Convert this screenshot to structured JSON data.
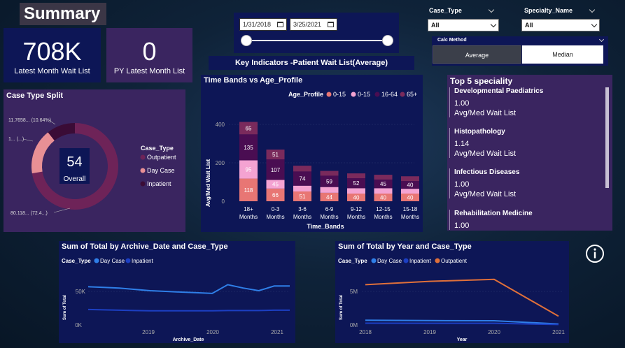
{
  "header": {
    "title": "Summary"
  },
  "kpis": [
    {
      "value": "708K",
      "label": "Latest Month Wait List"
    },
    {
      "value": "0",
      "label": "PY Latest Month List"
    }
  ],
  "date_slicer": {
    "start": "1/31/2018",
    "end": "3/25/2021"
  },
  "slicers": {
    "case_type": {
      "label": "Case_Type",
      "selected": "All"
    },
    "specialty": {
      "label": "Specialty_Name",
      "selected": "All"
    }
  },
  "calc_method": {
    "label": "Calc Method",
    "options": [
      "Average",
      "Median"
    ],
    "selected": "Average"
  },
  "key_indicators": "Key Indicators -Patient Wait List(Average)",
  "case_type_split": {
    "title": "Case Type Split",
    "center_value": "54",
    "center_label": "Overall",
    "legend_title": "Case_Type",
    "slices": [
      {
        "name": "Outpatient",
        "value": 72.4,
        "label": "80.118... (72.4...)",
        "color": "#6e2358"
      },
      {
        "name": "Day Case",
        "value": 16.96,
        "label": "1... (...)",
        "color": "#e89095"
      },
      {
        "name": "Inpatient",
        "value": 10.64,
        "label": "11.7658... (10.64%)",
        "color": "#3a0c36"
      }
    ]
  },
  "time_bands": {
    "title": "Time Bands vs Age_Profile",
    "legend_title": "Age_Profile",
    "legend": [
      {
        "name": "0-15",
        "color": "#e87674"
      },
      {
        "name": "0-15",
        "color": "#f4a3d2"
      },
      {
        "name": "16-64",
        "color": "#4a0d52"
      },
      {
        "name": "65+",
        "color": "#7a2a5c"
      }
    ],
    "ylabel": "Avg/Med Wait List",
    "xlabel": "Time_Bands",
    "yticks": [
      "0",
      "200",
      "400"
    ],
    "categories": [
      [
        "18+",
        "Months"
      ],
      [
        "0-3",
        "Months"
      ],
      [
        "3-6",
        "Months"
      ],
      [
        "6-9",
        "Months"
      ],
      [
        "9-12",
        "Months"
      ],
      [
        "12-15",
        "Months"
      ],
      [
        "15-18",
        "Months"
      ]
    ]
  },
  "top5": {
    "title": "Top 5 speciality",
    "items": [
      {
        "name": "Developmental Paediatrics",
        "value": "1.00",
        "sub": "Avg/Med Wait List"
      },
      {
        "name": "Histopathology",
        "value": "1.14",
        "sub": "Avg/Med Wait List"
      },
      {
        "name": "Infectious Diseases",
        "value": "1.00",
        "sub": "Avg/Med Wait List"
      },
      {
        "name": "Rehabilitation Medicine",
        "value": "1.00",
        "sub": ""
      }
    ]
  },
  "archive_chart": {
    "title": "Sum of Total by Archive_Date and Case_Type",
    "legend_title": "Case_Type",
    "legend": [
      {
        "name": "Day Case",
        "color": "#2f7fe8"
      },
      {
        "name": "Inpatient",
        "color": "#1c3fc2"
      }
    ],
    "ylabel": "Sum of Total",
    "xlabel": "Archive_Date",
    "yticks": [
      "0K",
      "50K"
    ],
    "xticks": [
      "2019",
      "2020",
      "2021"
    ]
  },
  "year_chart": {
    "title": "Sum of Total by Year and Case_Type",
    "legend_title": "Case_Type",
    "legend": [
      {
        "name": "Day Case",
        "color": "#2f7fe8"
      },
      {
        "name": "Inpatient",
        "color": "#1c3fc2"
      },
      {
        "name": "Outpatient",
        "color": "#e0703a"
      }
    ],
    "ylabel": "Sum of Total",
    "xlabel": "Year",
    "yticks": [
      "0M",
      "5M"
    ],
    "xticks": [
      "2018",
      "2019",
      "2020",
      "2021"
    ]
  },
  "chart_data": [
    {
      "type": "pie",
      "title": "Case Type Split",
      "categories": [
        "Outpatient",
        "Day Case",
        "Inpatient"
      ],
      "values": [
        72.4,
        16.96,
        10.64
      ]
    },
    {
      "type": "bar",
      "title": "Time Bands vs Age_Profile",
      "xlabel": "Time_Bands",
      "ylabel": "Avg/Med Wait List",
      "ylim": [
        0,
        450
      ],
      "categories": [
        "18+ Months",
        "0-3 Months",
        "3-6 Months",
        "6-9 Months",
        "9-12 Months",
        "12-15 Months",
        "15-18 Months"
      ],
      "series": [
        {
          "name": "0-15",
          "color": "#e87674",
          "values": [
            118,
            66,
            51,
            44,
            40,
            40,
            40
          ]
        },
        {
          "name": "0-15",
          "color": "#f4a3d2",
          "values": [
            95,
            45,
            30,
            30,
            28,
            28,
            25
          ]
        },
        {
          "name": "16-64",
          "color": "#4a0d52",
          "values": [
            135,
            107,
            74,
            59,
            52,
            45,
            40
          ]
        },
        {
          "name": "65+",
          "color": "#7a2a5c",
          "values": [
            65,
            51,
            30,
            25,
            25,
            25,
            25
          ]
        }
      ],
      "data_labels": [
        [
          "118",
          "95",
          "135",
          "65"
        ],
        [
          "66",
          "45",
          "107",
          "51"
        ],
        [
          "51",
          "",
          "74",
          ""
        ],
        [
          "44",
          "",
          "59",
          ""
        ],
        [
          "40",
          "",
          "52",
          ""
        ],
        [
          "40",
          "",
          "45",
          ""
        ],
        [
          "40",
          "",
          "40",
          ""
        ]
      ]
    },
    {
      "type": "line",
      "title": "Sum of Total by Archive_Date and Case_Type",
      "xlabel": "Archive_Date",
      "ylabel": "Sum of Total",
      "ylim": [
        0,
        70000
      ],
      "x": [
        "2018-01",
        "2018-04",
        "2018-07",
        "2018-10",
        "2019-01",
        "2019-04",
        "2019-07",
        "2019-10",
        "2020-01",
        "2020-04",
        "2020-07",
        "2020-10",
        "2021-01",
        "2021-03"
      ],
      "series": [
        {
          "name": "Day Case",
          "values": [
            57000,
            56000,
            55000,
            53000,
            51000,
            50000,
            49000,
            48000,
            47000,
            60000,
            55000,
            51000,
            58000,
            58000
          ]
        },
        {
          "name": "Inpatient",
          "values": [
            23000,
            22500,
            22000,
            21500,
            21000,
            21000,
            21000,
            21000,
            21000,
            21500,
            21500,
            21500,
            22000,
            22000
          ]
        }
      ]
    },
    {
      "type": "line",
      "title": "Sum of Total by Year and Case_Type",
      "xlabel": "Year",
      "ylabel": "Sum of Total",
      "ylim": [
        0,
        8000000
      ],
      "x": [
        "2018",
        "2019",
        "2020",
        "2021"
      ],
      "series": [
        {
          "name": "Day Case",
          "values": [
            700000,
            650000,
            620000,
            150000
          ]
        },
        {
          "name": "Inpatient",
          "values": [
            260000,
            250000,
            250000,
            60000
          ]
        },
        {
          "name": "Outpatient",
          "values": [
            6000000,
            6500000,
            6800000,
            1300000
          ]
        }
      ]
    }
  ]
}
